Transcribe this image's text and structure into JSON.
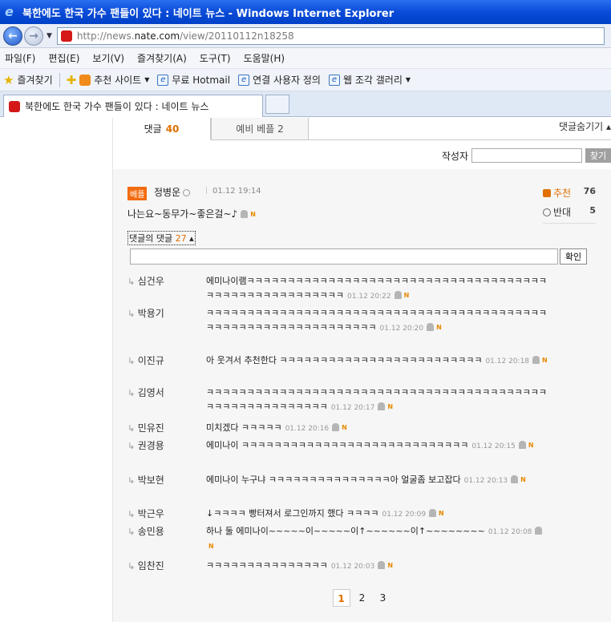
{
  "window": {
    "title": "북한에도 한국 가수 팬들이 있다 : 네이트 뉴스 - Windows Internet Explorer"
  },
  "address": {
    "url_prefix": "http://news.",
    "url_domain": "nate.com",
    "url_suffix": "/view/20110112n18258"
  },
  "menu": [
    "파일(F)",
    "편집(E)",
    "보기(V)",
    "즐겨찾기(A)",
    "도구(T)",
    "도움말(H)"
  ],
  "favorites": {
    "label": "즐겨찾기",
    "items": [
      "추천 사이트",
      "무료 Hotmail",
      "연결 사용자 정의",
      "웹 조각 갤러리"
    ]
  },
  "browser_tab": {
    "title": "북한에도 한국 가수 팬들이 있다 : 네이트 뉴스"
  },
  "comment_tabs": {
    "tab1_label": "댓글",
    "tab1_count": "40",
    "tab2_label": "예비 베플 2",
    "hide_label": "댓글숨기기 ▴"
  },
  "search": {
    "label": "작성자",
    "button": "찾기"
  },
  "best": {
    "badge": "베플",
    "author": "정병운",
    "time": "01.12 19:14",
    "text": "나는요~동무가~좋은걸~♪",
    "up_label": "추천",
    "up_count": "76",
    "down_label": "반대",
    "down_count": "5",
    "reply_toggle_label": "댓글의 댓글",
    "reply_count": "27",
    "confirm_button": "확인"
  },
  "replies": [
    {
      "author": "심건우",
      "text": "에미나이램ㅋㅋㅋㅋㅋㅋㅋㅋㅋㅋㅋㅋㅋㅋㅋㅋㅋㅋㅋㅋㅋㅋㅋㅋㅋㅋㅋㅋㅋㅋㅋㅋㅋㅋㅋㅋㅋㅋㅋㅋㅋㅋㅋㅋㅋㅋㅋㅋㅋㅋㅋㅋㅋㅋ",
      "time": "01.12 20:22"
    },
    {
      "author": "박용기",
      "text": "ㅋㅋㅋㅋㅋㅋㅋㅋㅋㅋㅋㅋㅋㅋㅋㅋㅋㅋㅋㅋㅋㅋㅋㅋㅋㅋㅋㅋㅋㅋㅋㅋㅋㅋㅋㅋㅋㅋㅋㅋㅋㅋㅋㅋㅋㅋㅋㅋㅋㅋㅋㅋㅋㅋㅋㅋㅋㅋㅋㅋㅋㅋㅋ",
      "time": "01.12 20:20"
    },
    {
      "author": "이진규",
      "text": "아 웃겨서 추천한다 ㅋㅋㅋㅋㅋㅋㅋㅋㅋㅋㅋㅋㅋㅋㅋㅋㅋㅋㅋㅋㅋㅋㅋㅋㅋ",
      "time": "01.12 20:18"
    },
    {
      "author": "김영서",
      "text": "ㅋㅋㅋㅋㅋㅋㅋㅋㅋㅋㅋㅋㅋㅋㅋㅋㅋㅋㅋㅋㅋㅋㅋㅋㅋㅋㅋㅋㅋㅋㅋㅋㅋㅋㅋㅋㅋㅋㅋㅋㅋㅋㅋㅋㅋㅋㅋㅋㅋㅋㅋㅋㅋㅋㅋㅋㅋ",
      "time": "01.12 20:17"
    },
    {
      "author": "민유진",
      "text": "미치겠다 ㅋㅋㅋㅋㅋ",
      "time": "01.12 20:16"
    },
    {
      "author": "권경용",
      "text": "에미나이 ㅋㅋㅋㅋㅋㅋㅋㅋㅋㅋㅋㅋㅋㅋㅋㅋㅋㅋㅋㅋㅋㅋㅋㅋㅋㅋㅋㅋ",
      "time": "01.12 20:15"
    },
    {
      "author": "박보현",
      "text": "에미나이 누구냐 ㅋㅋㅋㅋㅋㅋㅋㅋㅋㅋㅋㅋㅋㅋㅋ아 얼굴좀 보고잡다",
      "time": "01.12 20:13"
    },
    {
      "author": "박근우",
      "text": "↓ㅋㅋㅋㅋ 빵터져서 로그인까지 했다 ㅋㅋㅋㅋ",
      "time": "01.12 20:09"
    },
    {
      "author": "송민용",
      "text": "하나 둘 에미나이~~~~~이~~~~~이↑~~~~~~이↑~~~~~~~~",
      "time": "01.12 20:08"
    },
    {
      "author": "임찬진",
      "text": "ㅋㅋㅋㅋㅋㅋㅋㅋㅋㅋㅋㅋㅋㅋㅋ",
      "time": "01.12 20:03"
    }
  ],
  "pager": {
    "pages": [
      "1",
      "2",
      "3"
    ],
    "current": "1"
  }
}
